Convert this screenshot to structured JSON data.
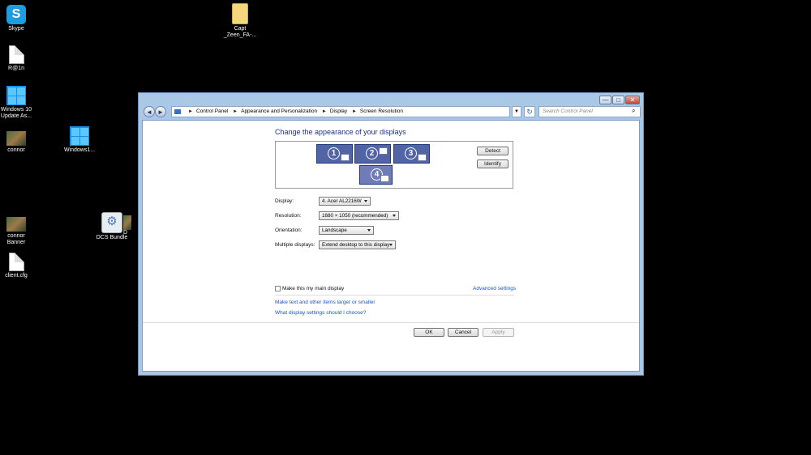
{
  "desktop": {
    "icons": [
      {
        "label": "Skype",
        "icon": "skype-icon"
      },
      {
        "label": "R@1n",
        "icon": "document-icon"
      },
      {
        "label": "Windows 10\nUpdate As...",
        "icon": "windows-logo-icon"
      },
      {
        "label": "connor",
        "icon": "image-file-icon"
      },
      {
        "label": "Windows1...",
        "icon": "windows-logo-icon"
      },
      {
        "label": "connor\nBanner",
        "icon": "image-file-icon"
      },
      {
        "label": "DCS Bundle",
        "icon": "settings-file-icon"
      },
      {
        "label": "D",
        "icon": "image-file-icon"
      },
      {
        "label": "client.cfg",
        "icon": "document-icon"
      },
      {
        "label": "Capt\n_Zeen_FA-...",
        "icon": "folder-icon"
      }
    ]
  },
  "window": {
    "controls": {
      "minimize": "—",
      "maximize": "□",
      "close": "✕"
    },
    "nav": {
      "back": "◄",
      "forward": "►",
      "refresh": "↻"
    },
    "breadcrumb": [
      "Control Panel",
      "Appearance and Personalization",
      "Display",
      "Screen Resolution"
    ],
    "search_placeholder": "Search Control Panel",
    "heading": "Change the appearance of your displays",
    "monitors": [
      "1",
      "2",
      "3",
      "4"
    ],
    "detect_label": "Detect",
    "identify_label": "Identify",
    "display_label": "Display:",
    "display_value": "4. Acer AL2216W",
    "resolution_label": "Resolution:",
    "resolution_value": "1680 × 1050 (recommended)",
    "orientation_label": "Orientation:",
    "orientation_value": "Landscape",
    "multiple_label": "Multiple displays:",
    "multiple_value": "Extend desktop to this display",
    "main_display_label": "Make this my main display",
    "advanced_link": "Advanced settings",
    "text_size_link": "Make text and other items larger or smaller",
    "help_link": "What display settings should I choose?",
    "ok_label": "OK",
    "cancel_label": "Cancel",
    "apply_label": "Apply"
  },
  "colors": {
    "accent_link": "#1a56c4",
    "heading": "#1e3287",
    "monitor_fill": "#5264a6"
  }
}
